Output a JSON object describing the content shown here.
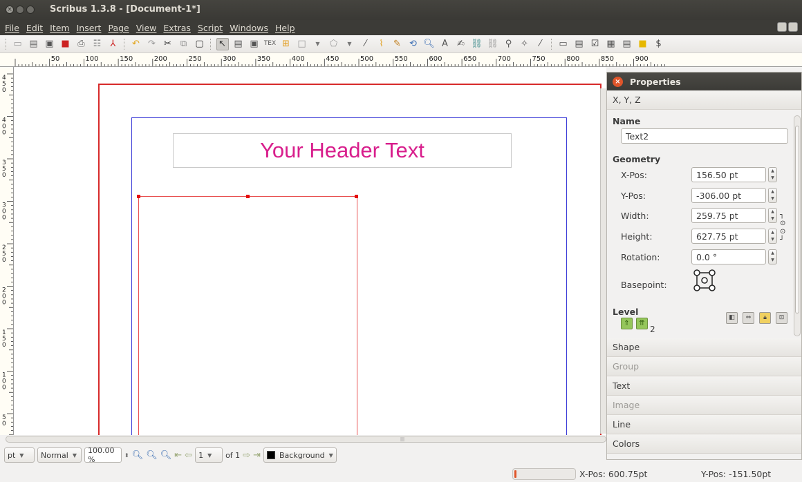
{
  "window": {
    "title": "Scribus 1.3.8 - [Document-1*]"
  },
  "menu": [
    "File",
    "Edit",
    "Item",
    "Insert",
    "Page",
    "View",
    "Extras",
    "Script",
    "Windows",
    "Help"
  ],
  "ruler": {
    "h_labels": [
      "50",
      "100",
      "150",
      "200",
      "250",
      "300",
      "350",
      "400",
      "450",
      "500",
      "550",
      "600",
      "650",
      "700",
      "750",
      "800",
      "850",
      "900"
    ],
    "v_labels": [
      "450",
      "400",
      "350",
      "300",
      "250",
      "200",
      "150",
      "100",
      "50"
    ]
  },
  "canvas": {
    "header_text": "Your Header Text"
  },
  "bottombar": {
    "unit": "pt",
    "mode": "Normal",
    "zoom": "100.00 %",
    "page": "1",
    "of_pages": "of 1",
    "layer": "Background"
  },
  "status": {
    "xpos": "X-Pos: 600.75pt",
    "ypos": "Y-Pos: -151.50pt",
    "progress": 0.02
  },
  "properties": {
    "title": "Properties",
    "xyz_tab": "X, Y, Z",
    "name_label": "Name",
    "name_value": "Text2",
    "geometry_label": "Geometry",
    "xpos_label": "X-Pos:",
    "xpos_value": "156.50 pt",
    "ypos_label": "Y-Pos:",
    "ypos_value": "-306.00 pt",
    "width_label": "Width:",
    "width_value": "259.75 pt",
    "height_label": "Height:",
    "height_value": "627.75 pt",
    "rotation_label": "Rotation:",
    "rotation_value": "0.0 °",
    "basepoint_label": "Basepoint:",
    "level_label": "Level",
    "level_value": "2",
    "sections": [
      {
        "label": "Shape",
        "enabled": true
      },
      {
        "label": "Group",
        "enabled": false
      },
      {
        "label": "Text",
        "enabled": true
      },
      {
        "label": "Image",
        "enabled": false
      },
      {
        "label": "Line",
        "enabled": true
      },
      {
        "label": "Colors",
        "enabled": true
      }
    ]
  },
  "colors": {
    "header_text": "#d81e8c",
    "page_margin": "#d72a2a",
    "page_guide": "#3d3dd8",
    "titlebar": "#3c3b37"
  }
}
